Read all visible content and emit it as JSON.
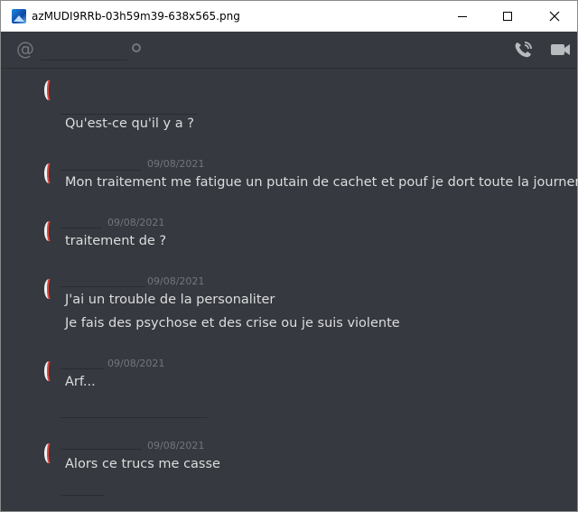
{
  "window": {
    "title": "azMUDI9RRb-03h59m39-638x565.png"
  },
  "header": {
    "at_symbol": "@"
  },
  "messages": [
    {
      "timestamp": "",
      "lines": [
        "Qu'est-ce qu'il y a ?"
      ]
    },
    {
      "timestamp": "09/08/2021",
      "lines": [
        "Mon traitement me fatigue un putain de cachet et pouf je dort toute la journer"
      ]
    },
    {
      "timestamp": "09/08/2021",
      "lines": [
        "traitement de ?"
      ]
    },
    {
      "timestamp": "09/08/2021",
      "lines": [
        "J'ai un trouble de la personaliter",
        "Je fais des psychose et des crise ou je suis violente"
      ]
    },
    {
      "timestamp": "09/08/2021",
      "lines": [
        "Arf..."
      ]
    },
    {
      "timestamp": "09/08/2021",
      "lines": [
        "Alors ce trucs me casse"
      ]
    }
  ],
  "icons": {
    "title_icon": "image-file-icon",
    "mention": "at-icon",
    "status": "status-dot-icon",
    "call": "phone-call-icon",
    "video": "video-camera-icon"
  },
  "colors": {
    "background": "#36393f",
    "message_text": "#dcddde",
    "timestamp": "#72767d",
    "avatar_accent": "#e0443d"
  }
}
